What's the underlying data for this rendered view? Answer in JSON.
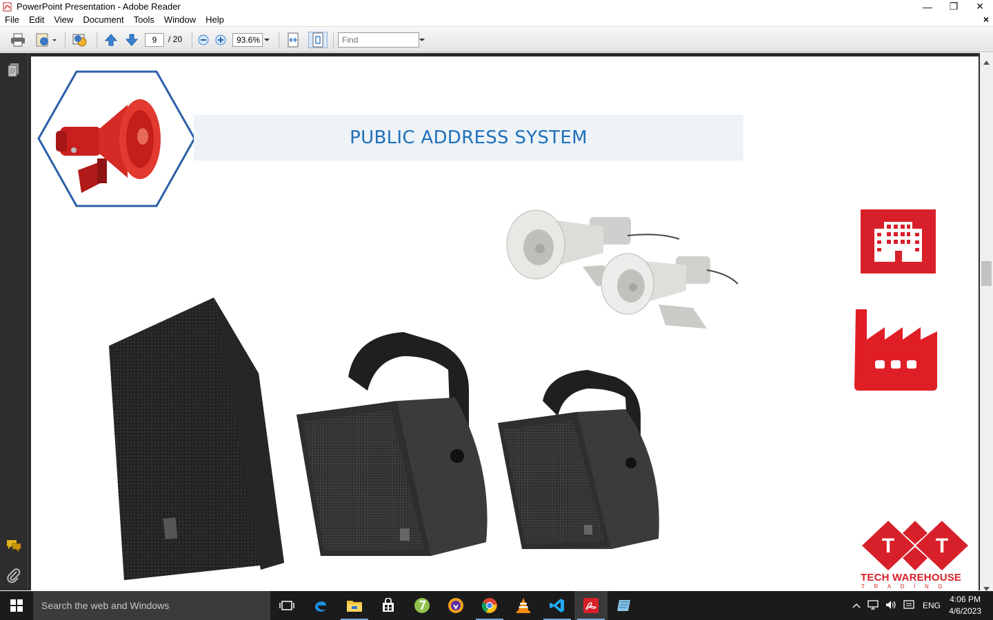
{
  "window": {
    "title": "PowerPoint Presentation - Adobe Reader",
    "minimize_glyph": "—",
    "restore_glyph": "❐",
    "close_glyph": "✕"
  },
  "menu": {
    "items": [
      "File",
      "Edit",
      "View",
      "Document",
      "Tools",
      "Window",
      "Help"
    ],
    "doc_close": "×"
  },
  "toolbar": {
    "current_page": "9",
    "page_total": "/ 20",
    "zoom": "93.6%",
    "find_placeholder": "Find"
  },
  "slide": {
    "title": "PUBLIC ADDRESS SYSTEM",
    "logo_name": "TECH WAREHOUSE",
    "logo_sub": "TRADING",
    "logo_letters": [
      "T",
      "T"
    ]
  },
  "taskbar": {
    "search_placeholder": "Search the web and Windows",
    "language": "ENG",
    "time": "4:06 PM",
    "date": "4/6/2023"
  },
  "colors": {
    "accent_blue": "#1f6fb8",
    "brand_red": "#d8202a",
    "banner_bg": "#eef3f8"
  }
}
